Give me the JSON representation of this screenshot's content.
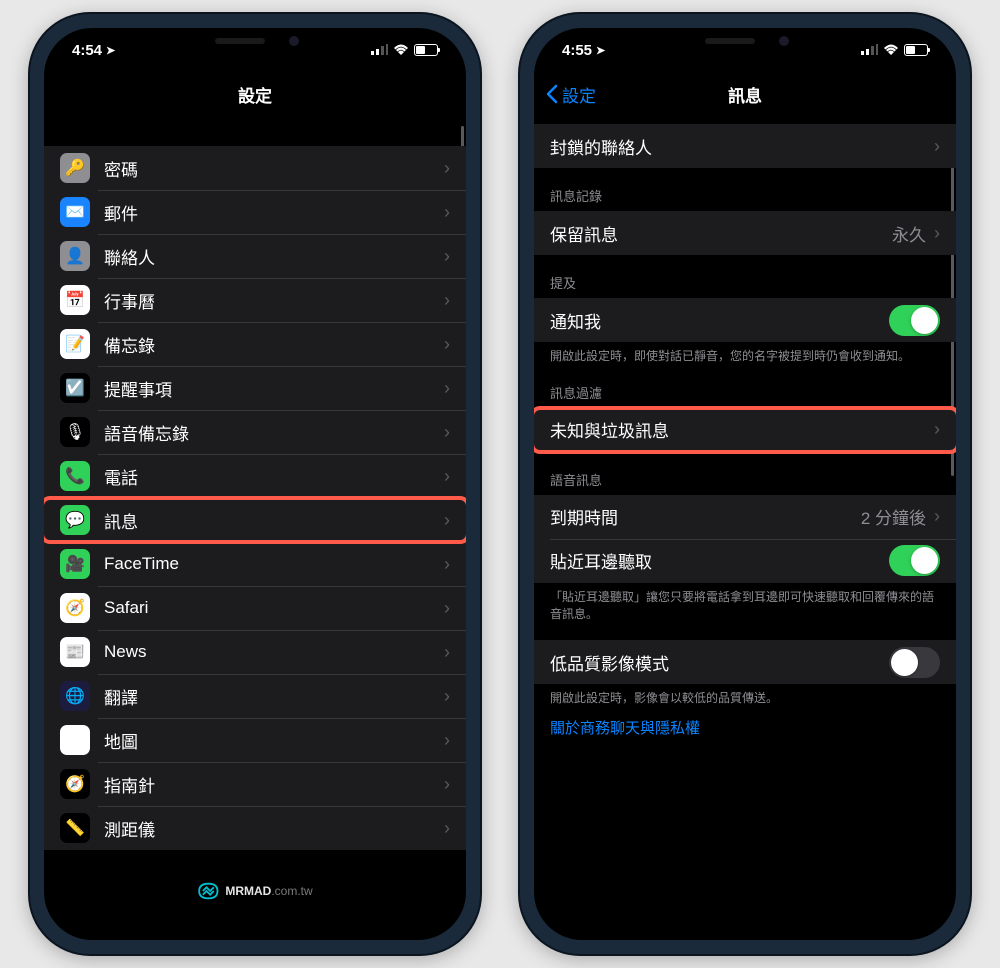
{
  "left": {
    "status": {
      "time": "4:54",
      "location_icon": "➤"
    },
    "nav": {
      "title": "設定"
    },
    "rows": [
      {
        "icon_bg": "#8e8e93",
        "icon": "🔑",
        "label": "密碼"
      },
      {
        "icon_bg": "#1a84ff",
        "icon": "✉️",
        "label": "郵件"
      },
      {
        "icon_bg": "#8e8e93",
        "icon": "👤",
        "label": "聯絡人"
      },
      {
        "icon_bg": "#ffffff",
        "icon": "📅",
        "label": "行事曆"
      },
      {
        "icon_bg": "#ffffff",
        "icon": "📝",
        "label": "備忘錄"
      },
      {
        "icon_bg": "#000000",
        "icon": "☑️",
        "label": "提醒事項"
      },
      {
        "icon_bg": "#000000",
        "icon": "🎙",
        "label": "語音備忘錄"
      },
      {
        "icon_bg": "#30d158",
        "icon": "📞",
        "label": "電話"
      },
      {
        "icon_bg": "#30d158",
        "icon": "💬",
        "label": "訊息",
        "highlight": true
      },
      {
        "icon_bg": "#30d158",
        "icon": "🎥",
        "label": "FaceTime"
      },
      {
        "icon_bg": "#ffffff",
        "icon": "🧭",
        "label": "Safari"
      },
      {
        "icon_bg": "#ffffff",
        "icon": "📰",
        "label": "News"
      },
      {
        "icon_bg": "#1c1c3e",
        "icon": "🌐",
        "label": "翻譯"
      },
      {
        "icon_bg": "#ffffff",
        "icon": "🗺",
        "label": "地圖"
      },
      {
        "icon_bg": "#000000",
        "icon": "🧭",
        "label": "指南針"
      },
      {
        "icon_bg": "#000000",
        "icon": "📏",
        "label": "測距儀"
      }
    ]
  },
  "right": {
    "status": {
      "time": "4:55",
      "location_icon": "➤"
    },
    "nav": {
      "back": "設定",
      "title": "訊息"
    },
    "sections": [
      {
        "rows": [
          {
            "label": "封鎖的聯絡人",
            "chevron": true
          }
        ]
      },
      {
        "header": "訊息記錄",
        "rows": [
          {
            "label": "保留訊息",
            "value": "永久",
            "chevron": true
          }
        ]
      },
      {
        "header": "提及",
        "rows": [
          {
            "label": "通知我",
            "toggle": "on"
          }
        ],
        "footer": "開啟此設定時，即使對話已靜音，您的名字被提到時仍會收到通知。"
      },
      {
        "header": "訊息過濾",
        "rows": [
          {
            "label": "未知與垃圾訊息",
            "chevron": true,
            "highlight": true
          }
        ]
      },
      {
        "header": "語音訊息",
        "rows": [
          {
            "label": "到期時間",
            "value": "2 分鐘後",
            "chevron": true
          },
          {
            "label": "貼近耳邊聽取",
            "toggle": "on"
          }
        ],
        "footer": "「貼近耳邊聽取」讓您只要將電話拿到耳邊即可快速聽取和回覆傳來的語音訊息。"
      },
      {
        "rows": [
          {
            "label": "低品質影像模式",
            "toggle": "off"
          }
        ],
        "footer": "開啟此設定時，影像會以較低的品質傳送。"
      }
    ],
    "link": "關於商務聊天與隱私權"
  },
  "watermark": {
    "brand": "MRMAD",
    "suffix": ".com.tw"
  }
}
